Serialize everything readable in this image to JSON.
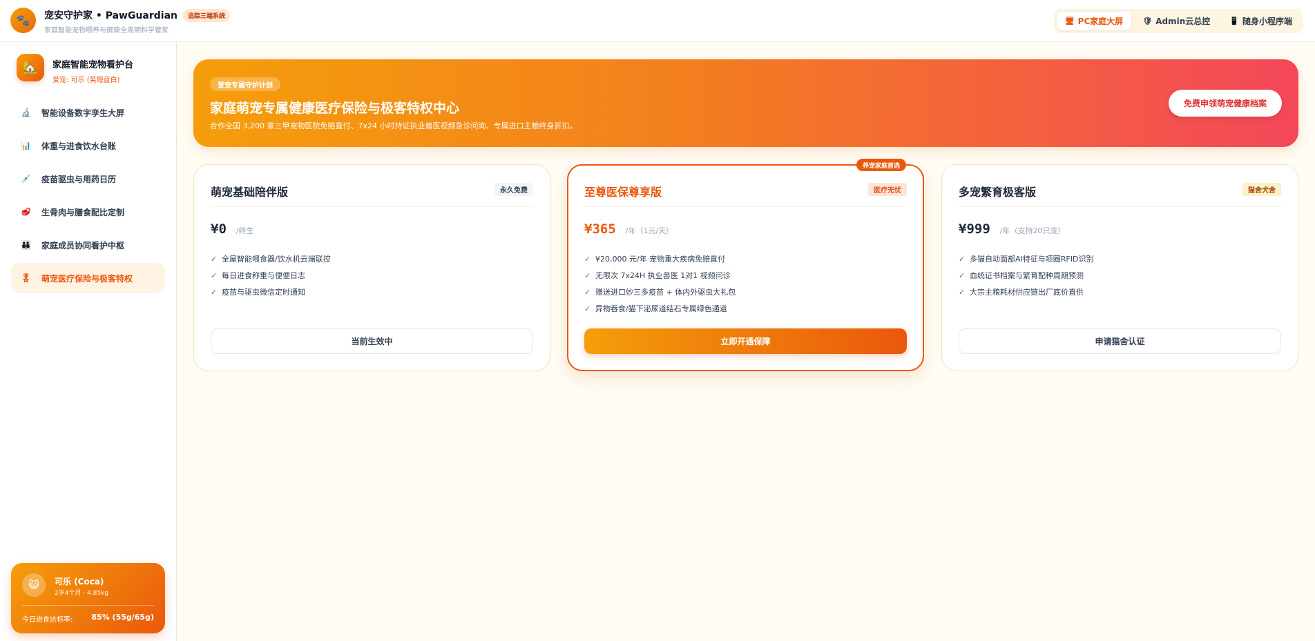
{
  "header": {
    "logo_icon": "paw-icon",
    "title": "宠安守护家 • PawGuardian",
    "badge": "追踪三端系统",
    "subtitle": "家庭智能宠物喂养与健康全周期科学管家",
    "nav": [
      {
        "label": "PC家庭大屏",
        "icon": "monitor-icon",
        "active": true
      },
      {
        "label": "Admin云总控",
        "icon": "shield-icon",
        "active": false
      },
      {
        "label": "随身小程序端",
        "icon": "phone-icon",
        "active": false
      }
    ]
  },
  "sidebar": {
    "title": "家庭智能宠物看护台",
    "subtitle": "爱宠: 可乐 (英短蓝白)",
    "items": [
      {
        "label": "智能设备数字孪生大屏",
        "icon": "microscope-icon"
      },
      {
        "label": "体重与进食饮水台账",
        "icon": "bar-chart-icon"
      },
      {
        "label": "疫苗驱虫与用药日历",
        "icon": "syringe-icon"
      },
      {
        "label": "生骨肉与膳食配比定制",
        "icon": "meat-icon"
      },
      {
        "label": "家庭成员协同看护中枢",
        "icon": "family-icon"
      },
      {
        "label": "萌宠医疗保险与极客特权",
        "icon": "medal-icon",
        "active": true
      }
    ],
    "pet_card": {
      "avatar_icon": "cat-face-icon",
      "name": "可乐 (Coca)",
      "meta": "2岁4个月 · 4.85kg",
      "intake_label": "今日进食达标率:",
      "intake_value": "85% (55g/65g)"
    }
  },
  "banner": {
    "tag": "爱宠专属守护计划",
    "title": "家庭萌宠专属健康医疗保险与极客特权中心",
    "description": "合作全国 3,200 家三甲宠物医院免赔直付、7x24 小时持证执业兽医视频急诊问询、专属进口主粮终身折扣。",
    "button": "免费申领萌宠健康档案"
  },
  "plans": [
    {
      "name": "萌宠基础陪伴版",
      "badge": "永久免费",
      "price": "¥0",
      "unit": "/终生",
      "features": [
        "全屋智能喂食器/饮水机云端联控",
        "每日进食称重与便便日志",
        "疫苗与驱虫微信定时通知"
      ],
      "button": "当前生效中"
    },
    {
      "ribbon": "养宠家庭首选",
      "name": "至尊医保尊享版",
      "badge": "医疗无忧",
      "price": "¥365",
      "unit": "/年（1元/天）",
      "features": [
        "¥20,000 元/年 宠物重大疾病免赔直付",
        "无限次 7x24H 执业兽医 1对1 视频问诊",
        "赠送进口妙三多疫苗 + 体内外驱虫大礼包",
        "异物吞食/猫下泌尿道结石专属绿色通道"
      ],
      "button": "立即开通保障"
    },
    {
      "name": "多宠繁育极客版",
      "badge": "猫舍犬舍",
      "price": "¥999",
      "unit": "/年（支持20只宠）",
      "features": [
        "多猫自动面部AI特征与项圈RFID识别",
        "血统证书档案与繁育配种周期预测",
        "大宗主粮耗材供应链出厂底价直供"
      ],
      "button": "申请猫舍认证"
    }
  ]
}
